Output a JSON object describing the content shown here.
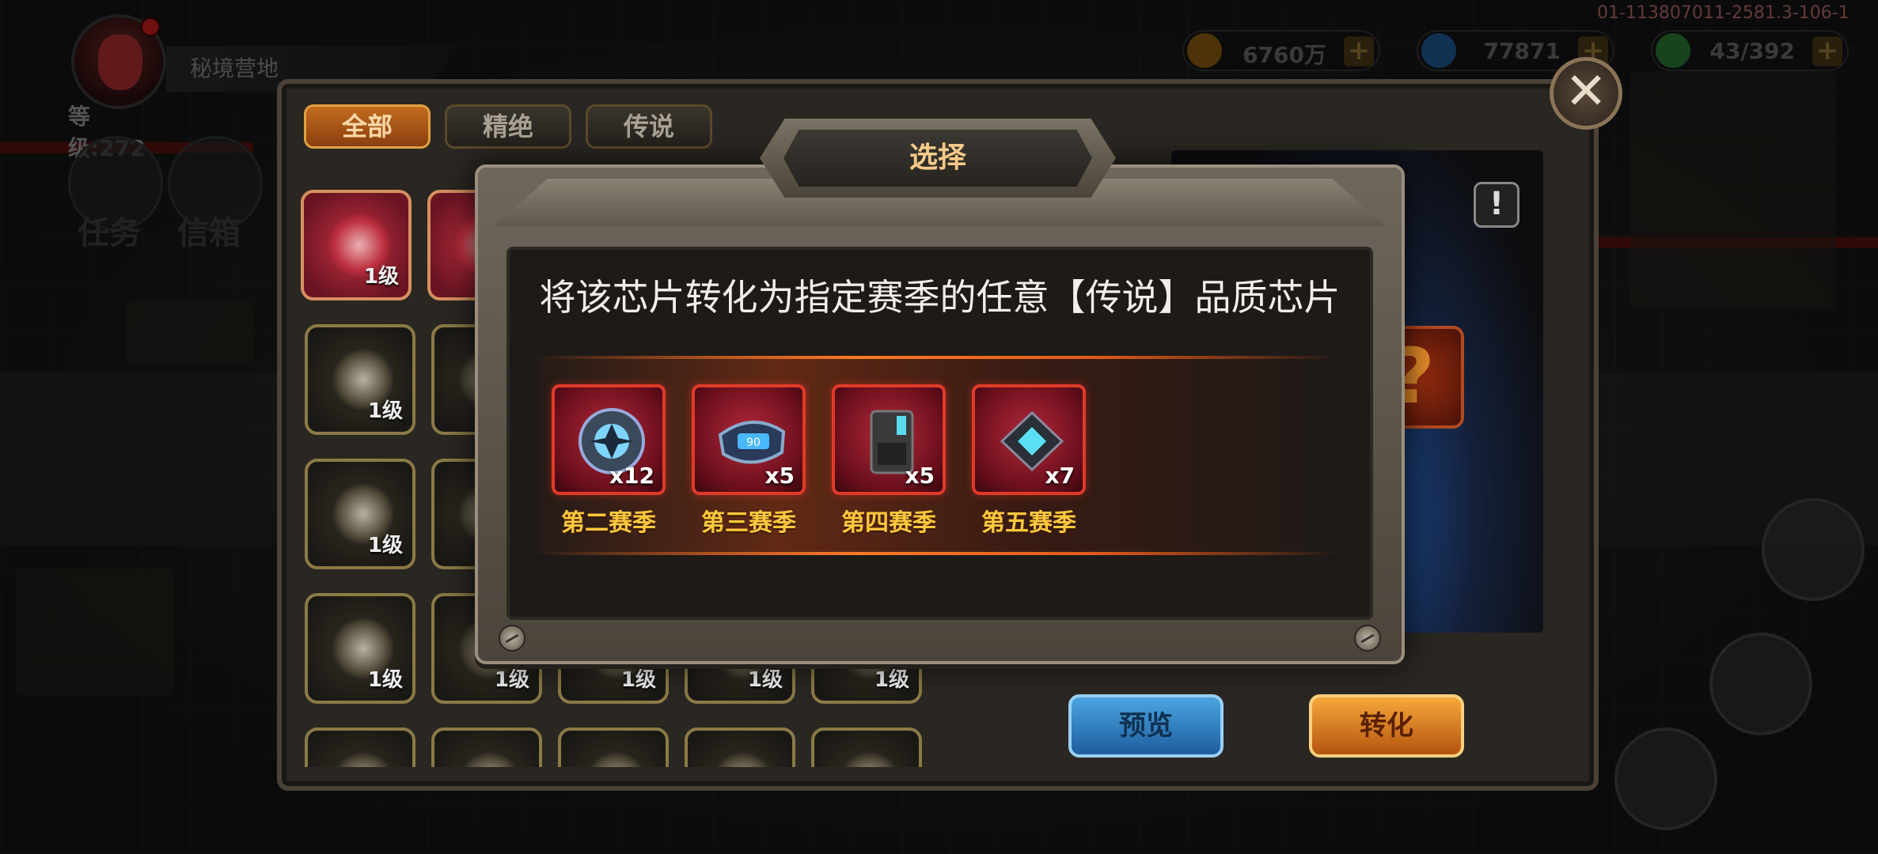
{
  "hud": {
    "location": "秘境营地",
    "level": "等级:272",
    "build_id": "01-113807011-2581.3-106-1",
    "resources": [
      {
        "icon": "gold-coin-icon",
        "value": "6760万",
        "color": "#b07a1a"
      },
      {
        "icon": "blue-gem-icon",
        "value": "77871",
        "color": "#2a7ac8"
      },
      {
        "icon": "green-energy-icon",
        "value": "43/392",
        "color": "#3aa84a"
      }
    ],
    "plus": "+",
    "side_labels": {
      "tasks": "任务",
      "mail": "信箱"
    }
  },
  "tabs": [
    {
      "label": "全部",
      "active": true
    },
    {
      "label": "精绝",
      "active": false
    },
    {
      "label": "传说",
      "active": false
    }
  ],
  "chip_grid": {
    "level_label": "1级"
  },
  "preview": {
    "mystery": "?",
    "info": "!"
  },
  "close": "✕",
  "buttons": {
    "preview": "预览",
    "convert": "转化"
  },
  "modal": {
    "title": "选择",
    "description": "将该芯片转化为指定赛季的任意【传说】品质芯片",
    "seasons": [
      {
        "name": "第二赛季",
        "count": "x12"
      },
      {
        "name": "第三赛季",
        "count": "x5"
      },
      {
        "name": "第四赛季",
        "count": "x5"
      },
      {
        "name": "第五赛季",
        "count": "x7"
      }
    ]
  }
}
